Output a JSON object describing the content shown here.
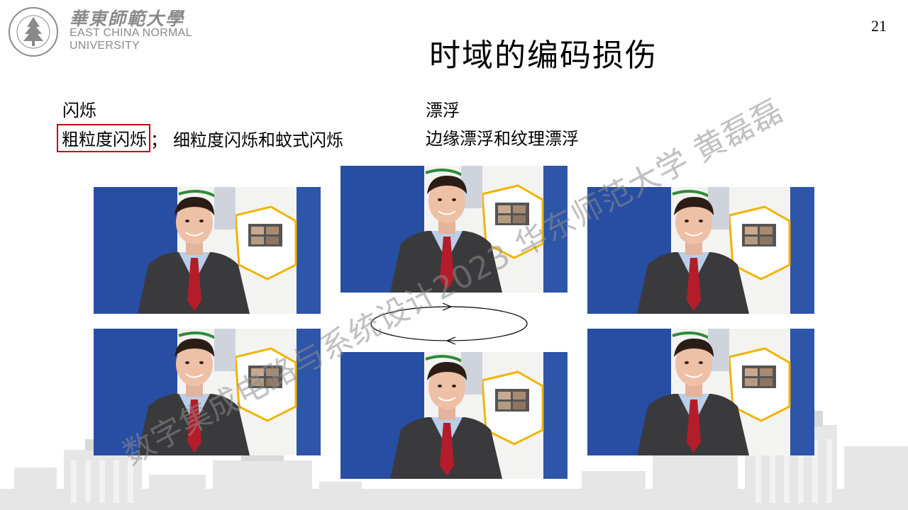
{
  "logo": {
    "name_cn": "華東師範大學",
    "name_en_line1": "EAST CHINA NORMAL",
    "name_en_line2": "UNIVERSITY"
  },
  "page_number": "21",
  "title": "时域的编码损伤",
  "flicker": {
    "heading": "闪烁",
    "highlighted": "粗粒度闪烁",
    "separator": "；",
    "rest": "细粒度闪烁和蚊式闪烁"
  },
  "drift": {
    "heading": "漂浮",
    "types": "边缘漂浮和纹理漂浮"
  },
  "watermark": "数字集成电路与系统设计2023 华东师范大学 黄磊磊",
  "colors": {
    "highlight_border": "#c00000",
    "studio_blue": "#274ea3",
    "watermark_gray": "#8c8c8c"
  }
}
